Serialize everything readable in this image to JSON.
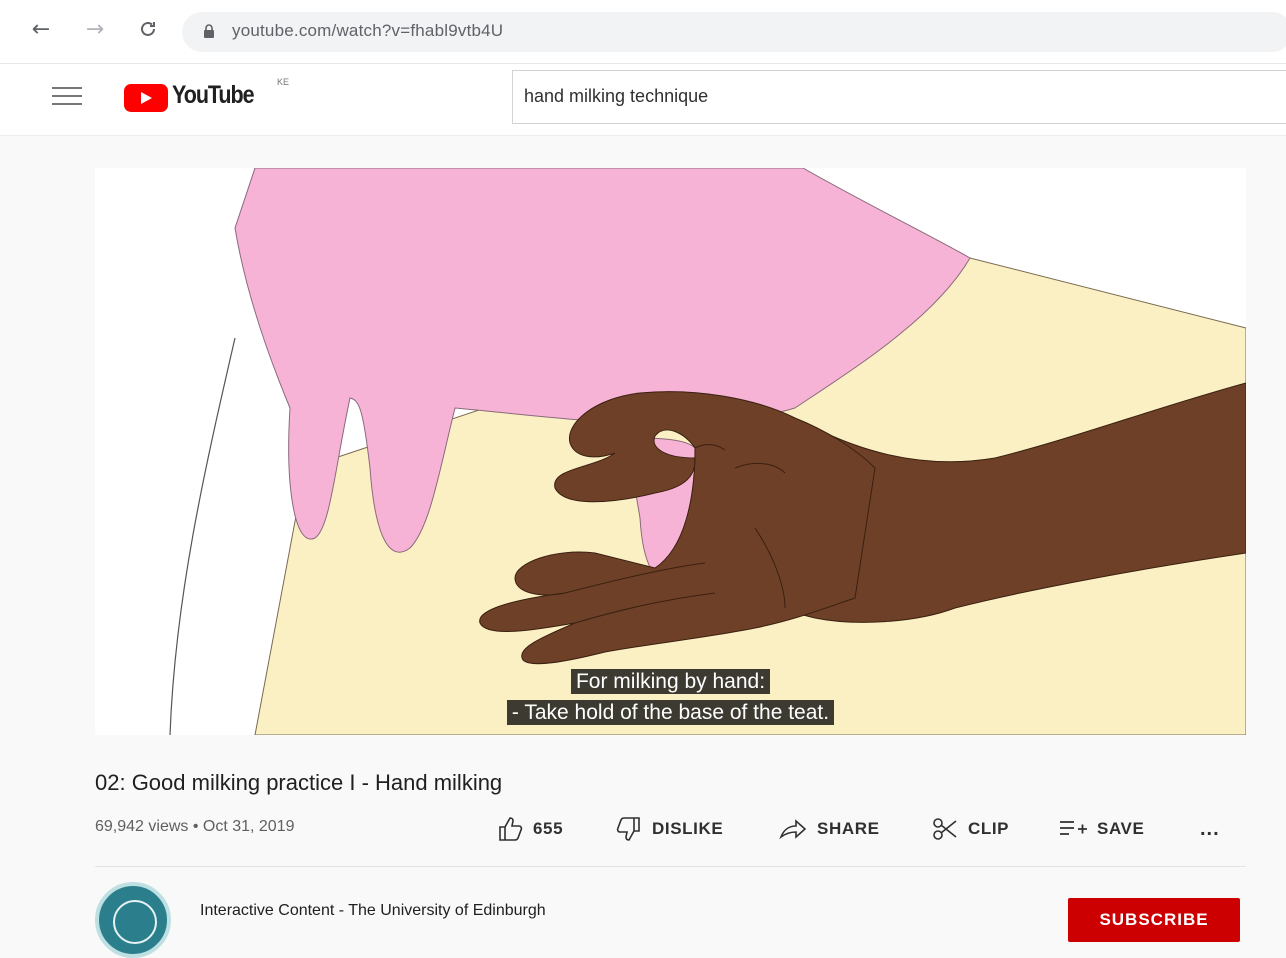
{
  "browser": {
    "url": "youtube.com/watch?v=fhabl9vtb4U",
    "back_icon": "←",
    "forward_icon": "→",
    "reload_icon": "C"
  },
  "header": {
    "logo_text": "YouTube",
    "country_code": "KE",
    "search_value": "hand milking technique"
  },
  "video": {
    "caption_line1": "For milking by hand:",
    "caption_line2": "- Take hold of the base of the teat."
  },
  "details": {
    "title": "02: Good milking practice I - Hand milking",
    "meta": "69,942 views • Oct 31, 2019",
    "like_count": "655",
    "dislike_label": "DISLIKE",
    "share_label": "SHARE",
    "clip_label": "CLIP",
    "save_label": "SAVE",
    "more_label": "..."
  },
  "channel": {
    "name": "Interactive Content - The University of Edinburgh",
    "subscribe_label": "SUBSCRIBE"
  },
  "colors": {
    "brand_red": "#ff0000",
    "subscribe_red": "#cc0000",
    "udder_pink": "#f7b3d6",
    "cow_cream": "#fbf0c4",
    "hand_brown": "#6e4028"
  }
}
